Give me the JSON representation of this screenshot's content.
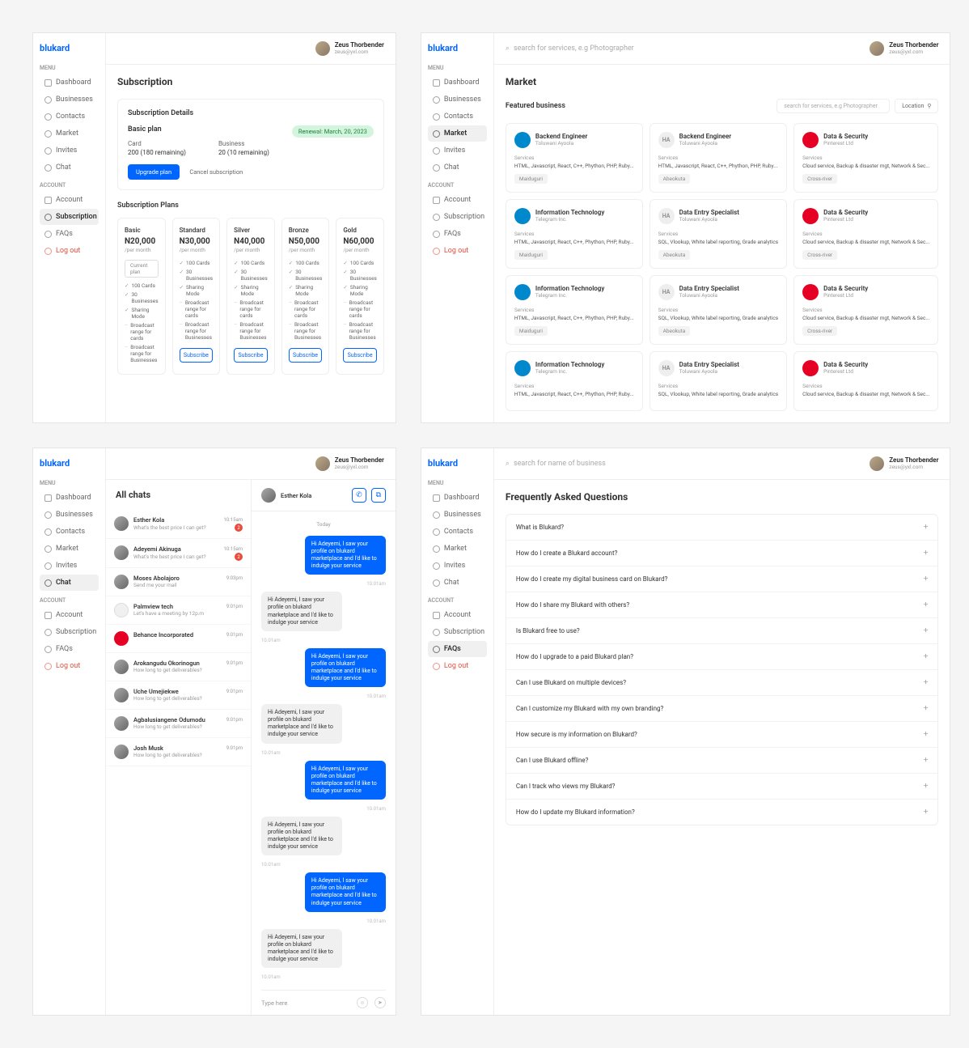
{
  "brand": {
    "part1": "bluk",
    "part2": "a",
    "part3": "rd"
  },
  "user": {
    "name": "Zeus Thorbender",
    "email": "zeus@yxl.com"
  },
  "menu": {
    "label_menu": "MENU",
    "label_account": "ACCOUNT",
    "items": [
      "Dashboard",
      "Businesses",
      "Contacts",
      "Market",
      "Invites",
      "Chat"
    ],
    "account_items": [
      "Account",
      "Subscription",
      "FAQs",
      "Log out"
    ]
  },
  "subscription": {
    "title": "Subscription",
    "details_title": "Subscription Details",
    "plan_name": "Basic plan",
    "renewal": "Renewal: March, 20, 2023",
    "card_label": "Card",
    "card_value": "200 (180 remaining)",
    "business_label": "Business",
    "business_value": "20 (10 remaining)",
    "upgrade": "Upgrade plan",
    "cancel": "Cancel subscription",
    "plans_title": "Subscription Plans",
    "current_label": "Current plan",
    "period": "/per month",
    "subscribe": "Subscribe",
    "plans": [
      {
        "name": "Basic",
        "price": "N20,000",
        "features": [
          {
            "t": "100 Cards",
            "on": true
          },
          {
            "t": "30 Businesses",
            "on": true
          },
          {
            "t": "Sharing Mode",
            "on": true
          },
          {
            "t": "Broadcast range for cards",
            "on": false
          },
          {
            "t": "Broadcast range for Businesses",
            "on": false
          }
        ],
        "current": true
      },
      {
        "name": "Standard",
        "price": "N30,000",
        "features": [
          {
            "t": "100 Cards",
            "on": true
          },
          {
            "t": "30 Businesses",
            "on": true
          },
          {
            "t": "Sharing Mode",
            "on": true
          },
          {
            "t": "Broadcast range for cards",
            "on": false
          },
          {
            "t": "Broadcast range for Businesses",
            "on": false
          }
        ]
      },
      {
        "name": "Silver",
        "price": "N40,000",
        "features": [
          {
            "t": "100 Cards",
            "on": true
          },
          {
            "t": "30 Businesses",
            "on": true
          },
          {
            "t": "Sharing Mode",
            "on": true
          },
          {
            "t": "Broadcast range for cards",
            "on": false
          },
          {
            "t": "Broadcast range for Businesses",
            "on": false
          }
        ]
      },
      {
        "name": "Bronze",
        "price": "N50,000",
        "features": [
          {
            "t": "100 Cards",
            "on": true
          },
          {
            "t": "30 Businesses",
            "on": true
          },
          {
            "t": "Sharing Mode",
            "on": true
          },
          {
            "t": "Broadcast range for cards",
            "on": false
          },
          {
            "t": "Broadcast range for Businesses",
            "on": false
          }
        ]
      },
      {
        "name": "Gold",
        "price": "N60,000",
        "features": [
          {
            "t": "100 Cards",
            "on": true
          },
          {
            "t": "30 Businesses",
            "on": true
          },
          {
            "t": "Sharing Mode",
            "on": true
          },
          {
            "t": "Broadcast range for cards",
            "on": false
          },
          {
            "t": "Broadcast range for Businesses",
            "on": false
          }
        ]
      }
    ]
  },
  "market": {
    "title": "Market",
    "search_placeholder": "search for services, e.g Photographer",
    "featured": "Featured business",
    "filter_placeholder": "search for services, e.g Photographer",
    "location": "Location",
    "services_label": "Services",
    "cards": [
      {
        "logo": "telegram",
        "name": "Backend Engineer",
        "sub": "Toluwani Ayoola",
        "services": "HTML, Javascript, React, C++, Phython, PHP, Ruby...",
        "tag": "Maiduguri"
      },
      {
        "logo": "ha",
        "name": "Backend Engineer",
        "sub": "Toluwani Ayoola",
        "services": "HTML, Javascript, React, C++, Phython, PHP, Ruby...",
        "tag": "Abeokuta"
      },
      {
        "logo": "pinterest",
        "name": "Data & Security",
        "sub": "Pinterest Ltd",
        "services": "Cloud service, Backup & disaster mgt, Network & Sec...",
        "tag": "Cross-river"
      },
      {
        "logo": "telegram",
        "name": "Information Technology",
        "sub": "Telegram Inc.",
        "services": "HTML, Javascript, React, C++, Phython, PHP, Ruby...",
        "tag": "Maiduguri"
      },
      {
        "logo": "ha",
        "name": "Data Entry Specialist",
        "sub": "Toluwani Ayoola",
        "services": "SQL, Vlookup, White label reporting, Grade analytics",
        "tag": "Abeokuta"
      },
      {
        "logo": "pinterest",
        "name": "Data & Security",
        "sub": "Pinterest Ltd",
        "services": "Cloud service, Backup & disaster mgt, Network & Sec...",
        "tag": "Cross-river"
      },
      {
        "logo": "telegram",
        "name": "Information Technology",
        "sub": "Telegram Inc.",
        "services": "HTML, Javascript, React, C++, Phython, PHP, Ruby...",
        "tag": "Maiduguri"
      },
      {
        "logo": "ha",
        "name": "Data Entry Specialist",
        "sub": "Toluwani Ayoola",
        "services": "SQL, Vlookup, White label reporting, Grade analytics",
        "tag": "Abeokuta"
      },
      {
        "logo": "pinterest",
        "name": "Data & Security",
        "sub": "Pinterest Ltd",
        "services": "Cloud service, Backup & disaster mgt, Network & Sec...",
        "tag": "Cross-river"
      },
      {
        "logo": "telegram",
        "name": "Information Technology",
        "sub": "Telegram Inc.",
        "services": "HTML, Javascript, React, C++, Phython, PHP, Ruby..."
      },
      {
        "logo": "ha",
        "name": "Data Entry Specialist",
        "sub": "Toluwani Ayoola",
        "services": "SQL, Vlookup, White label reporting, Grade analytics"
      },
      {
        "logo": "pinterest",
        "name": "Data & Security",
        "sub": "Pinterest Ltd",
        "services": "Cloud service, Backup & disaster mgt, Network & Sec..."
      }
    ]
  },
  "chat": {
    "list_title": "All chats",
    "composer_placeholder": "Type here",
    "day_label": "Today",
    "active_name": "Esther Kola",
    "msg_sent": "Hi Adeyemi, I saw your profile on blukard marketplace and I'd like to indulge your service",
    "msg_recv": "Hi Adeyemi, I saw your profile on blukard marketplace and I'd like to indulge your service",
    "time": "10.01am",
    "items": [
      {
        "name": "Esther Kola",
        "preview": "What's the best price I can get?",
        "time": "10:15am",
        "unread": 2
      },
      {
        "name": "Adeyemi Akinuga",
        "preview": "What's the best price I can get?",
        "time": "10:15am",
        "unread": 2
      },
      {
        "name": "Moses Abolajoro",
        "preview": "Send me your mail",
        "time": "9:03pm"
      },
      {
        "name": "Palmview tech",
        "preview": "Let's have a meeting by 12p.m",
        "time": "9:01pm",
        "logo": "telegram-sm"
      },
      {
        "name": "Behance Incorporated",
        "preview": "",
        "time": "9:01pm",
        "logo": "pinterest"
      },
      {
        "name": "Arokangudu Okorinogun",
        "preview": "How long to get deliverables?",
        "time": "9:01pm"
      },
      {
        "name": "Uche Umejiekwe",
        "preview": "How long to get deliverables?",
        "time": "9:01pm"
      },
      {
        "name": "Agbalusiangene Odumodu",
        "preview": "How long to get deliverables?",
        "time": "9:01pm"
      },
      {
        "name": "Josh Musk",
        "preview": "How long to get deliverables?",
        "time": "9:01pm"
      }
    ]
  },
  "faq": {
    "title": "Frequently Asked Questions",
    "search_placeholder": "search for name of business",
    "items": [
      "What is Blukard?",
      "How do I create a Blukard account?",
      "How do I create my digital business card on Blukard?",
      "How do I share my Blukard with others?",
      "Is Blukard free to use?",
      "How do I upgrade to a paid Blukard plan?",
      "Can I use Blukard on multiple devices?",
      "Can I customize my Blukard with my own branding?",
      "How secure is my information on Blukard?",
      "Can I use Blukard offline?",
      "Can I track who views my Blukard?",
      "How do I update my Blukard information?"
    ]
  }
}
